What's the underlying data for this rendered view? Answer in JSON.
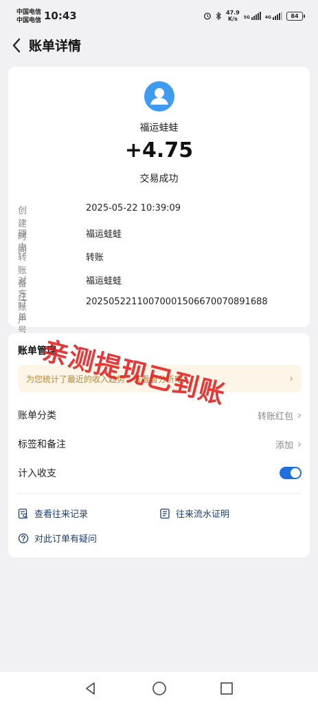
{
  "status_bar": {
    "carrier1": "中国电信",
    "carrier2": "中国电信",
    "time": "10:43",
    "speed_value": "47.9",
    "speed_unit": "K/s",
    "signal1_tag": "5G",
    "signal2_tag": "4G",
    "battery": "84"
  },
  "header": {
    "title": "账单详情"
  },
  "transaction": {
    "payer": "福运蛙蛙",
    "amount": "+4.75",
    "status": "交易成功",
    "details": [
      {
        "label": "创建时间",
        "value": "2025-05-22 10:39:09"
      },
      {
        "label": "理由",
        "value": "福运蛙蛙"
      },
      {
        "label": "转账备注",
        "value": "转账"
      },
      {
        "label": "对方账户",
        "value": "福运蛙蛙"
      },
      {
        "label": "订单号",
        "value": "20250522110070001506670070891688"
      }
    ]
  },
  "management": {
    "title": "账单管理",
    "banner": "为您统计了最近的收入趋势，去看看分析吧",
    "rows": {
      "category": {
        "label": "账单分类",
        "value": "转账红包"
      },
      "tags": {
        "label": "标签和备注",
        "value": "添加"
      },
      "income": {
        "label": "计入收支",
        "enabled": true
      }
    },
    "links": {
      "history": "查看往来记录",
      "statement": "往来流水证明",
      "question": "对此订单有疑问"
    }
  },
  "watermark": "亲测提现已到账",
  "colors": {
    "accent": "#1f6fe0",
    "avatar": "#3f9bf0",
    "stamp": "#e11e1e",
    "banner_text": "#b5872f"
  }
}
